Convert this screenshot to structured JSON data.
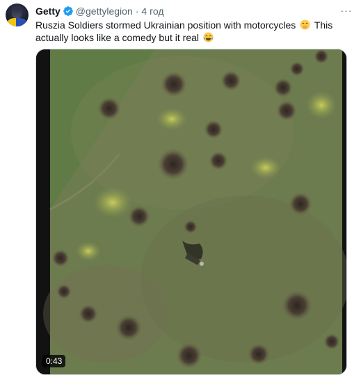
{
  "tweet": {
    "display_name": "Getty",
    "handle": "@gettylegion",
    "separator": "·",
    "time": "4 год",
    "text_part1": "Ruszia Soldiers stormed Ukrainian position with motorcycles",
    "text_part2": "This actually looks like a comedy but it real",
    "more_label": "···",
    "verified_icon": "verified-badge-icon",
    "emoji_1": "hand-over-mouth-emoji",
    "emoji_2": "tears-of-joy-emoji"
  },
  "media": {
    "duration": "0:43"
  },
  "colors": {
    "verified": "#1d9bf0",
    "text": "#0f1419",
    "secondary": "#536471"
  }
}
